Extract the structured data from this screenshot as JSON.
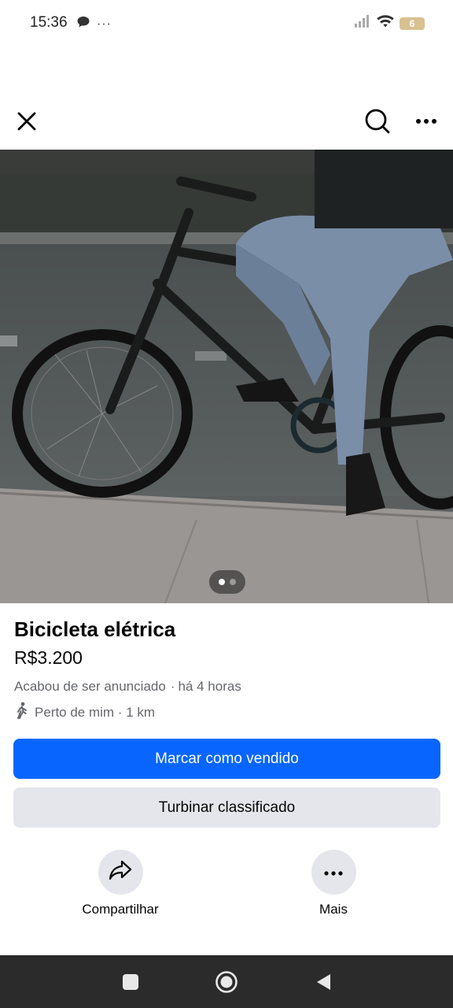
{
  "status_bar": {
    "time": "15:36",
    "more_glyph": "···",
    "battery_level": "6",
    "icons": [
      "chat-bubble-icon",
      "signal-icon",
      "wifi-icon",
      "battery-icon"
    ]
  },
  "top_bar": {
    "icons": [
      "close-icon",
      "search-icon",
      "more-horizontal-icon"
    ]
  },
  "photo": {
    "description_icon": "bicycle-photo",
    "page_count": 2,
    "current_page": 1
  },
  "listing": {
    "title": "Bicicleta elétrica",
    "price": "R$3.200",
    "status": "Acabou de ser anunciado",
    "time_ago": "há 4 horas",
    "location": "Perto de mim · 1 km"
  },
  "buttons": {
    "mark_sold": "Marcar como vendido",
    "boost": "Turbinar classificado"
  },
  "actions": {
    "share_label": "Compartilhar",
    "more_label": "Mais"
  },
  "colors": {
    "primary": "#0866ff",
    "secondary_bg": "#e4e6eb",
    "muted_text": "#65676b",
    "nav_bar": "#2b2b2b"
  }
}
